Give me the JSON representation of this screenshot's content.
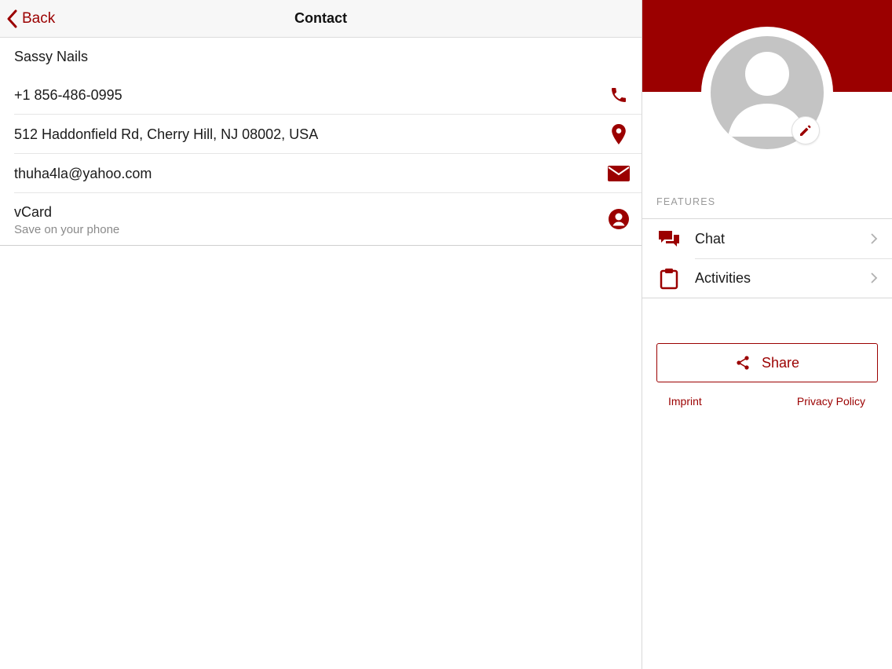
{
  "colors": {
    "accent": "#9b0000",
    "avatar_placeholder": "#c4c4c4",
    "divider": "#d8d8d8"
  },
  "nav": {
    "back_label": "Back",
    "title": "Contact"
  },
  "contact": {
    "name": "Sassy Nails",
    "phone": "+1 856-486-0995",
    "address": "512 Haddonfield Rd, Cherry Hill, NJ 08002, USA",
    "email": "thuha4la@yahoo.com",
    "vcard": {
      "title": "vCard",
      "subtitle": "Save on your phone"
    },
    "icons": [
      "phone-icon",
      "location-pin-icon",
      "envelope-icon",
      "person-circle-icon"
    ]
  },
  "sidebar": {
    "features_label": "FEATURES",
    "features": [
      {
        "label": "Chat",
        "icon": "chat-bubbles-icon"
      },
      {
        "label": "Activities",
        "icon": "clipboard-icon"
      }
    ],
    "share_label": "Share",
    "imprint_label": "Imprint",
    "privacy_label": "Privacy Policy"
  }
}
